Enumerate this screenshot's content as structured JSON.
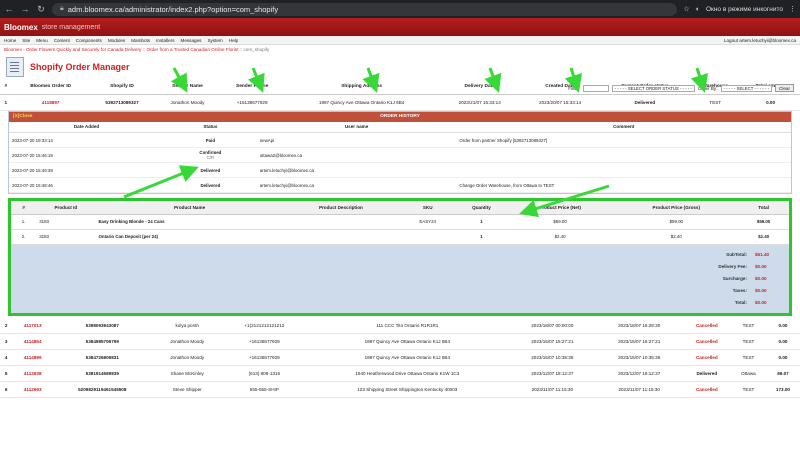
{
  "browser": {
    "url": "adm.bloomex.ca/administrator/index2.php?option=com_shopify",
    "incognito_text": "Окно в режиме инкогнито"
  },
  "app": {
    "logo": "Bloomex",
    "logo_sub": "store management"
  },
  "menu": {
    "items": [
      "Home",
      "Site",
      "Menu",
      "Content",
      "Components",
      "Modules",
      "Mambots",
      "Installers",
      "Messages",
      "System",
      "Help"
    ],
    "logout": "Logout artem.letuchyi@bloomex.ca"
  },
  "subbar": {
    "text": "Bloomex - Order Flowers Quickly and Securely for Canada Delivery :: Order from a Trusted Canadian Online Florist",
    "crumb": "com_shopify"
  },
  "page": {
    "title": "Shopify Order Manager"
  },
  "filter": {
    "filter_label": "Filter:",
    "status_placeholder": "- - - - - SELECT ORDER STATUS - - - - -",
    "order_by_label": "Order By:",
    "order_by_placeholder": "- - - - - SELECT - - - - - -",
    "clear_label": "Clear"
  },
  "orders": {
    "columns": [
      "#",
      "Bloomex Order ID",
      "Shopify ID",
      "Sender Name",
      "Sender Phone",
      "Shipping Address",
      "Delivery Date",
      "Created Date",
      "Current Order status",
      "Warehouse",
      "Total amount"
    ],
    "first": {
      "num": "1",
      "order_id": "4118897",
      "shopify_id": "5392713089327",
      "sender_name": "Jonathon Moody",
      "sender_phone": "+16138677929",
      "address": "1997 Quincy Ave Ottawa Ontario K1J 6B4",
      "delivery_date": "2023/21/07 15:33:14",
      "created_date": "2023/20/07 15:33:14",
      "status": "Delivered",
      "warehouse": "TEST",
      "total": "0.00"
    },
    "rest": [
      {
        "num": "2",
        "order_id": "4117013",
        "shopify_id": "5398093943087",
        "sender_name": "kolya porsh",
        "sender_phone": "+1(2121212121212",
        "address": "111 CCC Tito Ontario R1R1R1",
        "delivery_date": "2023/18/07 00:00:00",
        "created_date": "2023/18/07 15:28:30",
        "status": "Cancelled",
        "warehouse": "TEST",
        "total": "0.00"
      },
      {
        "num": "3",
        "order_id": "4114864",
        "shopify_id": "5384985706799",
        "sender_name": "Jonathon Moody",
        "sender_phone": "+16138677929",
        "address": "1997 Quincy Ave Ottawa Ontario K1J 6B4",
        "delivery_date": "2023/15/07 15:27:21",
        "created_date": "2023/15/07 15:27:21",
        "status": "Cancelled",
        "warehouse": "TEST",
        "total": "0.00"
      },
      {
        "num": "4",
        "order_id": "4114899",
        "shopify_id": "5384726806831",
        "sender_name": "Jonathon Moody",
        "sender_phone": "+16138677929",
        "address": "1997 Quincy Ave Ottawa Ontario K1J 6B4",
        "delivery_date": "2023/15/07 10:35:36",
        "created_date": "2023/15/07 10:35:36",
        "status": "Cancelled",
        "warehouse": "TEST",
        "total": "0.00"
      },
      {
        "num": "5",
        "order_id": "4113638",
        "shopify_id": "5381914689839",
        "sender_name": "Shane McKinley",
        "sender_phone": "(613) 808-1316",
        "address": "1940 Heatherwood Drive Ottawa Ontario K1W 1C3",
        "delivery_date": "2023/12/07 18:12:37",
        "created_date": "2023/12/07 18:12:37",
        "status": "Delivered",
        "warehouse": "Ottawa",
        "total": "69.07"
      },
      {
        "num": "6",
        "order_id": "4112693",
        "shopify_id": "5209829119461545508",
        "sender_name": "Steve Shipper",
        "sender_phone": "555-555-SHIP",
        "address": "123 Shipping Street Shippington Kentucky 40003",
        "delivery_date": "2023/11/07 11:15:30",
        "created_date": "2023/11/07 11:15:30",
        "status": "Cancelled",
        "warehouse": "TEST",
        "total": "173.00"
      }
    ]
  },
  "history": {
    "close_label": "[X]Close",
    "title": "ORDER HISTORY",
    "columns": [
      "Date Added",
      "Status",
      "User name",
      "Comment"
    ],
    "rows": [
      {
        "date": "2023-07-20 19:33:14",
        "status": "Paid",
        "status_sub": "",
        "user": "newApi",
        "comment": "Order from partner Shopify [5392713089327]"
      },
      {
        "date": "2023-07-20 15:46:19",
        "status": "Confirmed",
        "status_sub": "C/R",
        "user": "ottawa2@bloomex.ca",
        "comment": ""
      },
      {
        "date": "2023-07-20 15:49:39",
        "status": "Delivered",
        "status_sub": "",
        "user": "artem.letuchyi@bloomex.ca",
        "comment": ""
      },
      {
        "date": "2023-07-20 15:48:46",
        "status": "Delivered",
        "status_sub": "",
        "user": "artem.letuchyi@bloomex.ca",
        "comment": "Change Order Warehouse, from Ottawa to TEST"
      }
    ]
  },
  "products": {
    "columns": [
      "#",
      "Product Id",
      "Product Name",
      "Product Description",
      "SKU",
      "Quantity",
      "Product Price (Net)",
      "Product Price (Gross)",
      "Total"
    ],
    "rows": [
      {
        "num": "1.",
        "id": "3183",
        "name": "Easy Drinking Blonde - 24 Cans",
        "desc": "",
        "sku": "EASY24",
        "qty": "1",
        "net": "$59.00",
        "gross": "$59.00",
        "total": "$59.00"
      },
      {
        "num": "2.",
        "id": "3183",
        "name": "Ontario Can Deposit (per 24)",
        "desc": "",
        "sku": "",
        "qty": "1",
        "net": "$2.40",
        "gross": "$2.40",
        "total": "$2.40"
      }
    ],
    "totals": [
      {
        "label": "SubTotal:",
        "value": "$61.40"
      },
      {
        "label": "Delivery Fee:",
        "value": "$0.00"
      },
      {
        "label": "Surcharge:",
        "value": "$0.00"
      },
      {
        "label": "Taxes:",
        "value": "$0.00"
      },
      {
        "label": "Total:",
        "value": "$0.00"
      }
    ]
  }
}
